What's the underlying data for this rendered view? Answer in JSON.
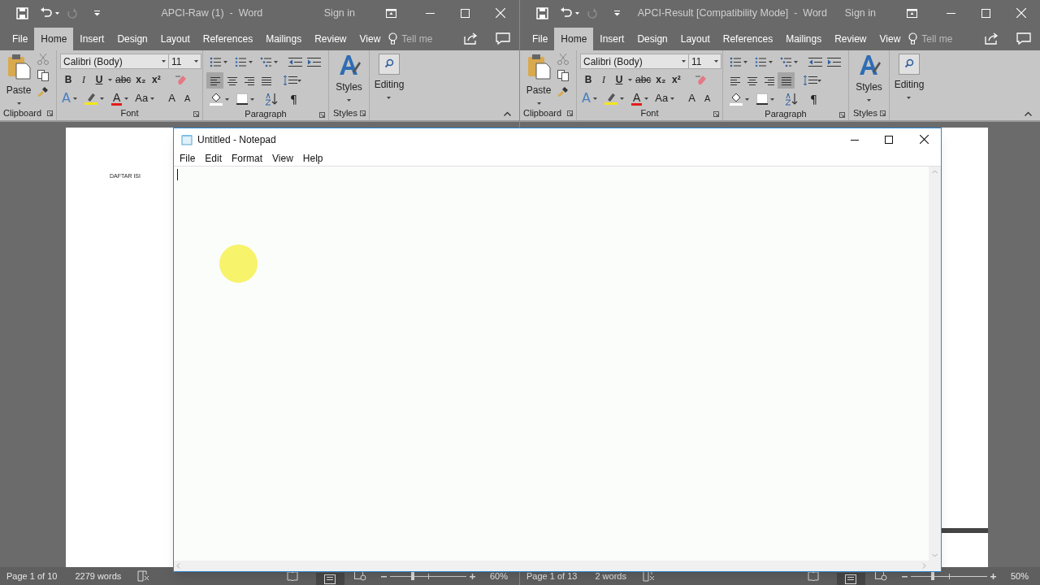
{
  "word_windows": [
    {
      "title": "APCI-Raw (1)  -  Word",
      "sign_in": "Sign in",
      "tell_me": "Tell me",
      "tabs": [
        {
          "label": "File",
          "selected": false
        },
        {
          "label": "Home",
          "selected": true
        },
        {
          "label": "Insert",
          "selected": false
        },
        {
          "label": "Design",
          "selected": false
        },
        {
          "label": "Layout",
          "selected": false
        },
        {
          "label": "References",
          "selected": false
        },
        {
          "label": "Mailings",
          "selected": false
        },
        {
          "label": "Review",
          "selected": false
        },
        {
          "label": "View",
          "selected": false
        }
      ],
      "paste": "Paste",
      "font_name": "Calibri (Body)",
      "font_size": "11",
      "format_buttons": [
        {
          "kind": "bold",
          "label": "B"
        },
        {
          "kind": "italic",
          "label": "I"
        },
        {
          "kind": "underline",
          "label": "U"
        },
        {
          "kind": "strike",
          "label": "abc"
        },
        {
          "kind": "sub",
          "label": "x₂"
        },
        {
          "kind": "sup",
          "label": "x²"
        }
      ],
      "font_row": [
        {
          "kind": "effects",
          "label": "A"
        },
        {
          "kind": "highlight"
        },
        {
          "kind": "font_color",
          "label": "A"
        },
        {
          "kind": "case",
          "label": "Aa"
        },
        {
          "kind": "grow",
          "label": "A"
        },
        {
          "kind": "shrink",
          "label": "A"
        }
      ],
      "alignment": [
        {
          "selected": true
        },
        {
          "selected": false
        },
        {
          "selected": false
        },
        {
          "selected": false
        }
      ],
      "show_marks": "¶",
      "styles": "Styles",
      "editing": "Editing",
      "group_labels": [
        "Clipboard",
        "Font",
        "Paragraph",
        "Styles"
      ],
      "document": {
        "heading": "DAFTAR ISI"
      },
      "status": {
        "page": "Page 1 of 10",
        "words": "2279 words",
        "zoom": "60%",
        "zoom_slider": {
          "level": 0.3
        }
      }
    },
    {
      "title": "APCI-Result [Compatibility Mode]  -  Word",
      "sign_in": "Sign in",
      "tell_me": "Tell me",
      "tabs": [
        {
          "label": "File",
          "selected": false
        },
        {
          "label": "Home",
          "selected": true
        },
        {
          "label": "Insert",
          "selected": false
        },
        {
          "label": "Design",
          "selected": false
        },
        {
          "label": "Layout",
          "selected": false
        },
        {
          "label": "References",
          "selected": false
        },
        {
          "label": "Mailings",
          "selected": false
        },
        {
          "label": "Review",
          "selected": false
        },
        {
          "label": "View",
          "selected": false
        }
      ],
      "paste": "Paste",
      "font_name": "Calibri (Body)",
      "font_size": "11",
      "format_buttons": [
        {
          "kind": "bold",
          "label": "B"
        },
        {
          "kind": "italic",
          "label": "I"
        },
        {
          "kind": "underline",
          "label": "U"
        },
        {
          "kind": "strike",
          "label": "abc"
        },
        {
          "kind": "sub",
          "label": "x₂"
        },
        {
          "kind": "sup",
          "label": "x²"
        }
      ],
      "font_row": [
        {
          "kind": "effects",
          "label": "A"
        },
        {
          "kind": "highlight"
        },
        {
          "kind": "font_color",
          "label": "A"
        },
        {
          "kind": "case",
          "label": "Aa"
        },
        {
          "kind": "grow",
          "label": "A"
        },
        {
          "kind": "shrink",
          "label": "A"
        }
      ],
      "alignment": [
        {
          "selected": false
        },
        {
          "selected": false
        },
        {
          "selected": false
        },
        {
          "selected": true
        }
      ],
      "show_marks": "¶",
      "styles": "Styles",
      "editing": "Editing",
      "group_labels": [
        "Clipboard",
        "Font",
        "Paragraph",
        "Styles"
      ],
      "status": {
        "page": "Page 1 of 13",
        "words": "2 words",
        "zoom": "50%",
        "zoom_slider": {
          "level": 0.29
        }
      }
    }
  ],
  "notepad": {
    "title": "Untitled - Notepad",
    "menu": [
      "File",
      "Edit",
      "Format",
      "View",
      "Help"
    ]
  }
}
